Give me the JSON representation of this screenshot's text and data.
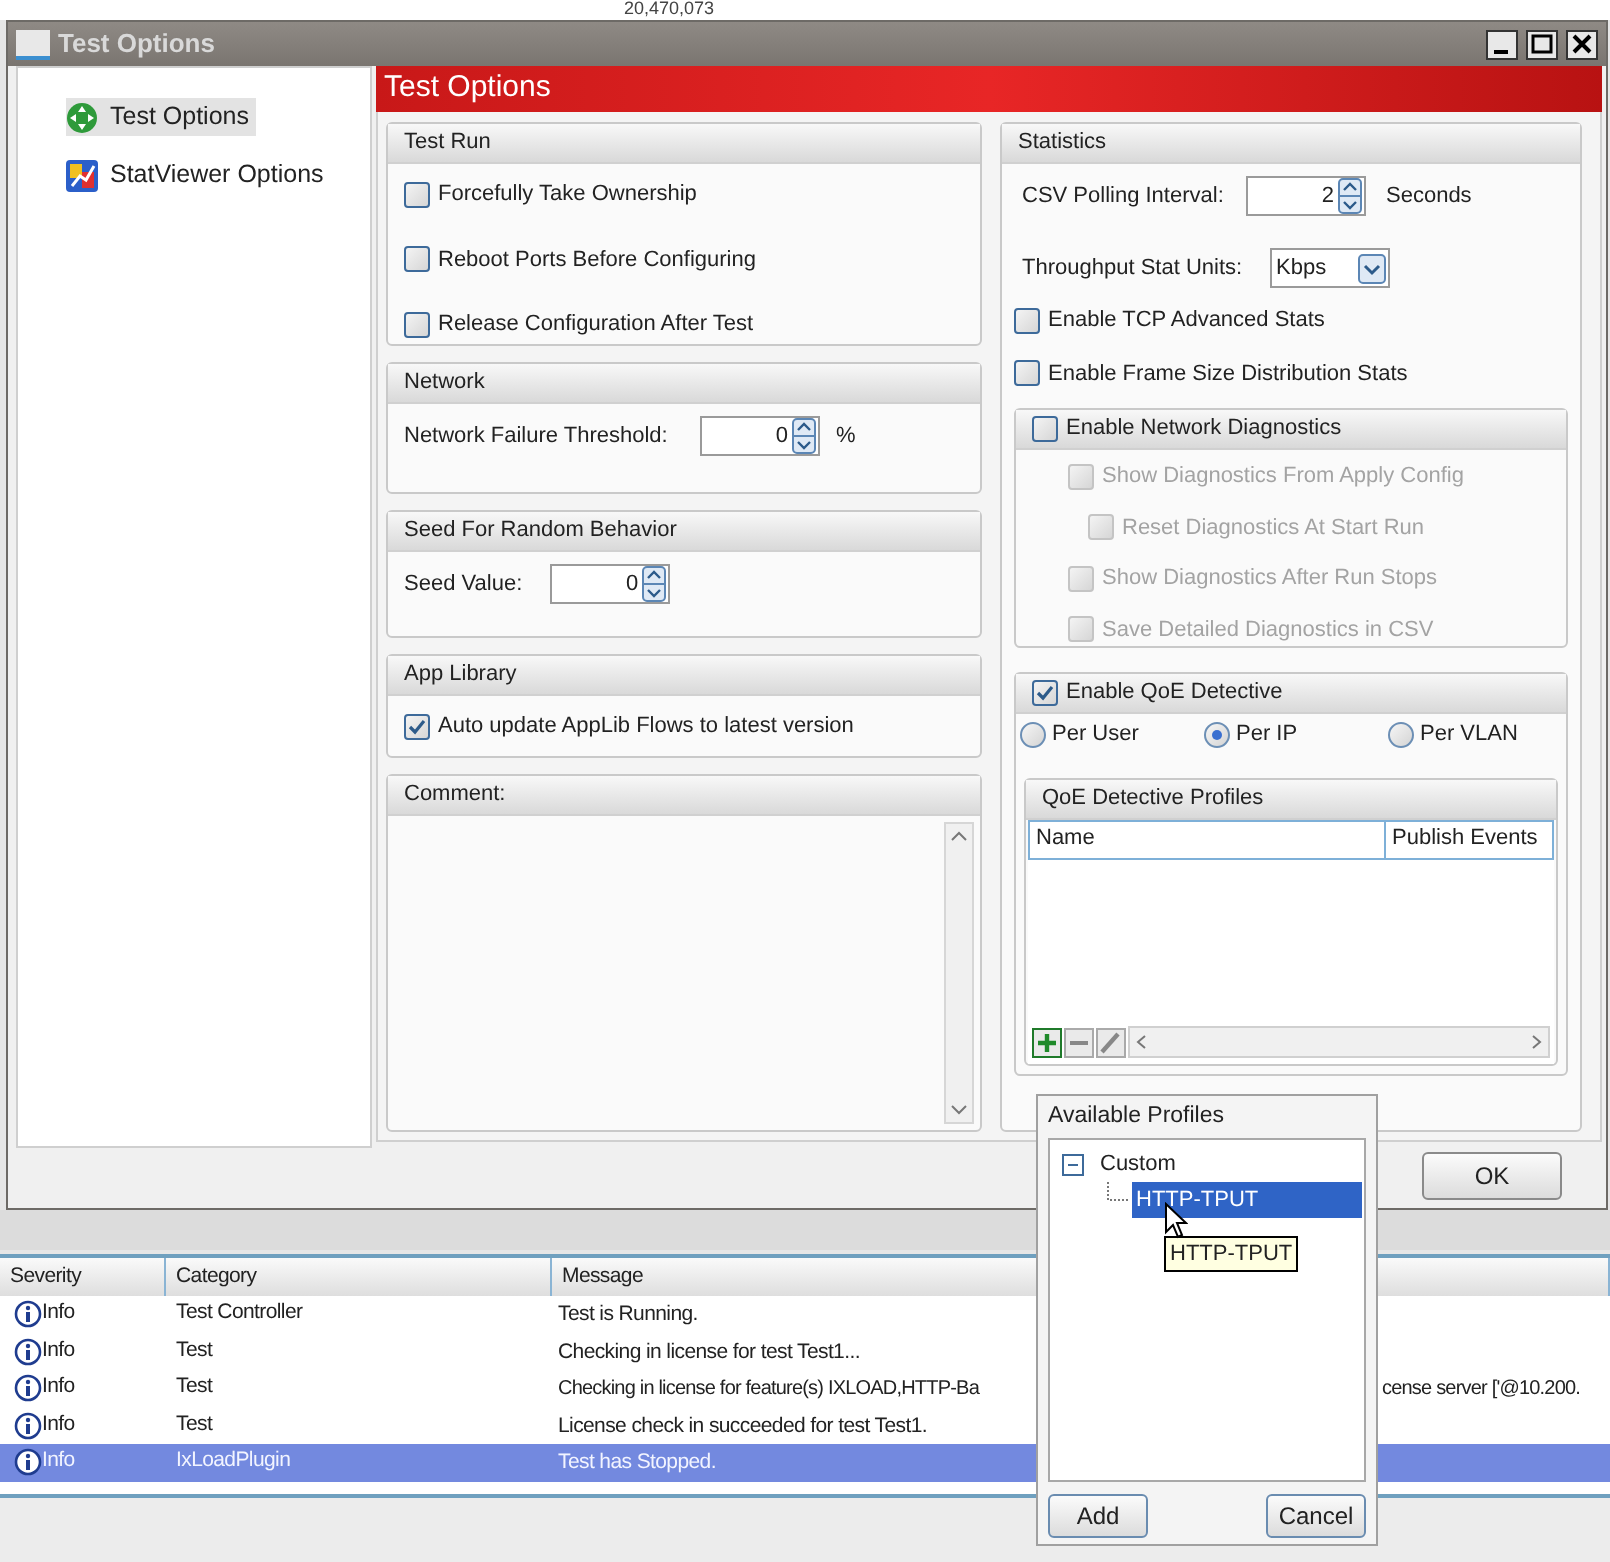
{
  "background": {
    "counter": "20,470,073"
  },
  "dialog": {
    "title": "Test Options",
    "sidebar": {
      "items": [
        {
          "label": "Test Options",
          "selected": true,
          "kind": "test"
        },
        {
          "label": "StatViewer Options",
          "selected": false,
          "kind": "stat"
        }
      ]
    },
    "header": "Test Options",
    "test_run": {
      "title": "Test Run",
      "options": [
        {
          "label": "Forcefully Take Ownership",
          "checked": false
        },
        {
          "label": "Reboot Ports Before Configuring",
          "checked": false
        },
        {
          "label": "Release Configuration After Test",
          "checked": false
        }
      ]
    },
    "network": {
      "title": "Network",
      "label": "Network Failure Threshold:",
      "value": "0",
      "unit": "%"
    },
    "seed": {
      "title": "Seed For Random Behavior",
      "label": "Seed Value:",
      "value": "0"
    },
    "app_library": {
      "title": "App Library",
      "option": {
        "label": "Auto update AppLib Flows to latest version",
        "checked": true
      }
    },
    "comment": {
      "title": "Comment:"
    },
    "statistics": {
      "title": "Statistics",
      "csv_label": "CSV Polling Interval:",
      "csv_value": "2",
      "csv_unit": "Seconds",
      "units_label": "Throughput Stat Units:",
      "units_value": "Kbps",
      "options": [
        {
          "label": "Enable TCP Advanced Stats",
          "checked": false
        },
        {
          "label": "Enable Frame Size Distribution Stats",
          "checked": false
        }
      ]
    },
    "network_diagnostics": {
      "label": "Enable Network Diagnostics",
      "checked": false,
      "options": [
        {
          "label": "Show Diagnostics From Apply Config",
          "checked": false,
          "disabled": true,
          "children": [
            {
              "label": "Reset Diagnostics At Start Run",
              "checked": false,
              "disabled": true
            }
          ]
        },
        {
          "label": "Show Diagnostics After Run Stops",
          "checked": false,
          "disabled": true
        },
        {
          "label": "Save Detailed Diagnostics in CSV",
          "checked": false,
          "disabled": true
        }
      ]
    },
    "qoe": {
      "label": "Enable QoE Detective",
      "checked": true,
      "modes": [
        {
          "label": "Per User",
          "selected": false
        },
        {
          "label": "Per IP",
          "selected": true
        },
        {
          "label": "Per VLAN",
          "selected": false
        }
      ],
      "profiles": {
        "title": "QoE Detective Profiles",
        "columns": [
          "Name",
          "Publish Events"
        ]
      }
    },
    "ok_button": "OK"
  },
  "popup": {
    "title": "Available Profiles",
    "tree": [
      {
        "label": "Custom",
        "expanded": true,
        "selected": false,
        "children": [
          {
            "label": "HTTP-TPUT",
            "selected": true
          }
        ]
      }
    ],
    "tooltip": "HTTP-TPUT",
    "buttons": [
      "Add",
      "Cancel"
    ]
  },
  "log": {
    "columns": [
      "Severity",
      "Category",
      "Message"
    ],
    "rows": [
      {
        "severity": "Info",
        "category": "Test Controller",
        "message": "Test is Running.",
        "selected": false
      },
      {
        "severity": "Info",
        "category": "Test",
        "message": "Checking in license for test Test1...",
        "selected": false
      },
      {
        "severity": "Info",
        "category": "Test",
        "message": "Checking in license for feature(s) IXLOAD,HTTP-Ba",
        "message_after": "cense server ['@10.200.",
        "selected": false
      },
      {
        "severity": "Info",
        "category": "Test",
        "message": "License check in succeeded for test Test1.",
        "selected": false
      },
      {
        "severity": "Info",
        "category": "IxLoadPlugin",
        "message": "Test has Stopped.",
        "selected": true
      }
    ]
  }
}
